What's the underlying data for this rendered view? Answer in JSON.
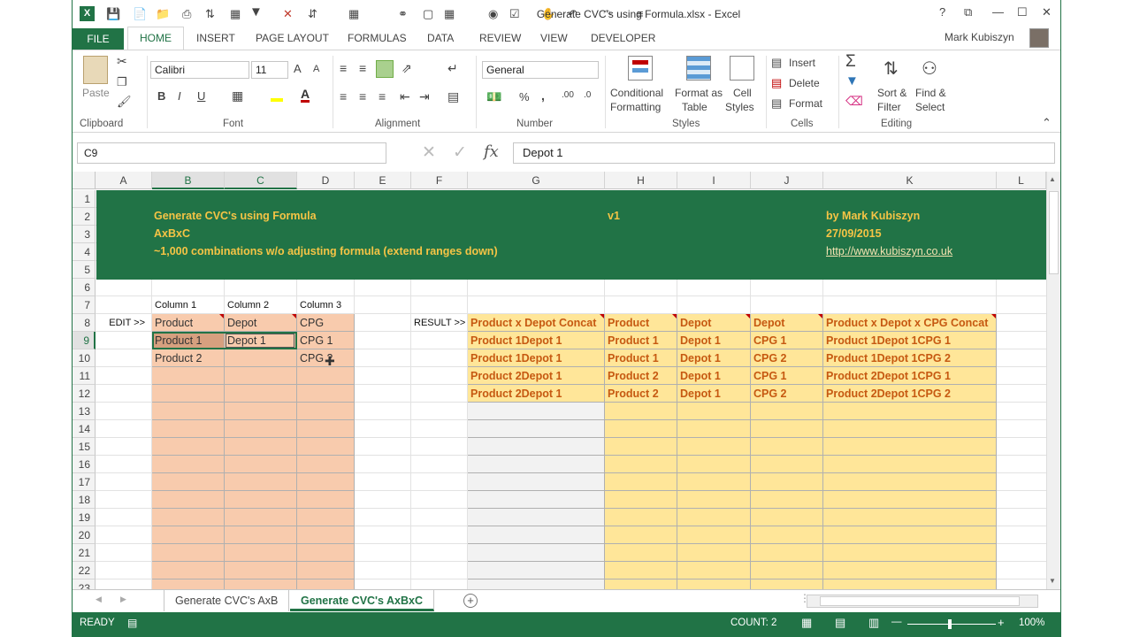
{
  "window": {
    "title": "Generate CVC's using Formula.xlsx - Excel",
    "help": "?",
    "restore": "⧉",
    "minimize": "—",
    "maximize": "☐",
    "close": "✕",
    "user_name": "Mark Kubiszyn"
  },
  "ribbon_tabs": {
    "file": "FILE",
    "home": "HOME",
    "insert": "INSERT",
    "page_layout": "PAGE LAYOUT",
    "formulas": "FORMULAS",
    "data": "DATA",
    "review": "REVIEW",
    "view": "VIEW",
    "developer": "DEVELOPER"
  },
  "ribbon": {
    "clipboard": {
      "paste": "Paste",
      "label": "Clipboard"
    },
    "font": {
      "name": "Calibri",
      "size": "11",
      "bold": "B",
      "italic": "I",
      "underline": "U",
      "grow": "A",
      "shrink": "A",
      "label": "Font"
    },
    "alignment": {
      "label": "Alignment"
    },
    "number": {
      "format": "General",
      "percent": "%",
      "comma": ",",
      "label": "Number"
    },
    "styles": {
      "conditional": "Conditional",
      "conditional2": "Formatting",
      "format_table": "Format as",
      "format_table2": "Table",
      "cell_styles": "Cell",
      "cell_styles2": "Styles",
      "label": "Styles"
    },
    "cells": {
      "insert": "Insert",
      "delete": "Delete",
      "format": "Format",
      "label": "Cells"
    },
    "editing": {
      "sort": "Sort &",
      "sort2": "Filter",
      "find": "Find &",
      "find2": "Select",
      "label": "Editing"
    }
  },
  "formula_bar": {
    "name_box": "C9",
    "fx": "fx",
    "cancel": "✕",
    "enter": "✓",
    "content": "Depot 1"
  },
  "columns": [
    "A",
    "B",
    "C",
    "D",
    "E",
    "F",
    "G",
    "H",
    "I",
    "J",
    "K",
    "L"
  ],
  "rows": [
    "1",
    "2",
    "3",
    "4",
    "5",
    "6",
    "7",
    "8",
    "9",
    "10",
    "11",
    "12",
    "13",
    "14",
    "15",
    "16",
    "17",
    "18",
    "19",
    "20",
    "21",
    "22",
    "23"
  ],
  "banner": {
    "title": "Generate CVC's using Formula",
    "subtitle": "AxBxC",
    "note": "~1,000 combinations w/o adjusting formula (extend ranges down)",
    "version": "v1",
    "author": "by Mark Kubiszyn",
    "date": "27/09/2015",
    "url": "http://www.kubiszyn.co.uk"
  },
  "edit_table": {
    "edit_label": "EDIT >>",
    "headers": [
      "Column 1",
      "Column 2",
      "Column 3"
    ],
    "rows": [
      [
        "Product",
        "Depot",
        "CPG"
      ],
      [
        "Product 1",
        "Depot 1",
        "CPG 1"
      ],
      [
        "Product 2",
        "",
        "CPG 2"
      ]
    ]
  },
  "result_table": {
    "result_label": "RESULT >>",
    "headers": [
      "Product x Depot Concat",
      "Product",
      "Depot",
      "Depot",
      "Product x Depot x CPG Concat"
    ],
    "rows": [
      [
        "Product 1Depot 1",
        "Product 1",
        "Depot 1",
        "CPG 1",
        "Product 1Depot 1CPG 1"
      ],
      [
        "Product 1Depot 1",
        "Product 1",
        "Depot 1",
        "CPG 2",
        "Product 1Depot 1CPG 2"
      ],
      [
        "Product 2Depot 1",
        "Product 2",
        "Depot 1",
        "CPG 1",
        "Product 2Depot 1CPG 1"
      ],
      [
        "Product 2Depot 1",
        "Product 2",
        "Depot 1",
        "CPG 2",
        "Product 2Depot 1CPG 2"
      ]
    ]
  },
  "sheet_tabs": {
    "tab1": "Generate CVC's AxB",
    "tab2": "Generate CVC's AxBxC",
    "add": "+"
  },
  "status_bar": {
    "ready": "READY",
    "count": "COUNT: 2",
    "zoom": "100%",
    "zoom_out": "—",
    "zoom_in": "+"
  }
}
